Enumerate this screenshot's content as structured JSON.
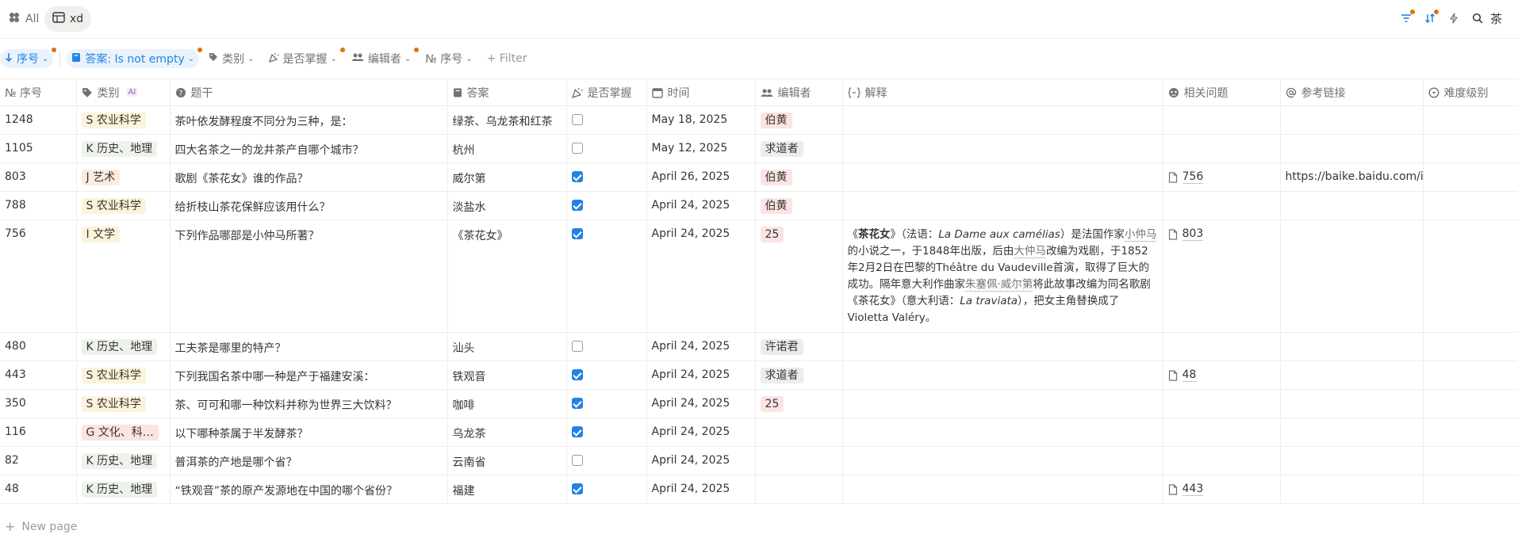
{
  "tabs": [
    {
      "label": "All",
      "icon": "clover-icon"
    },
    {
      "label": "xd",
      "icon": "table-icon"
    }
  ],
  "toolbar": {
    "search_query": "茶"
  },
  "filters": [
    {
      "label": "序号",
      "icon": "arrow-down-icon",
      "style": "blue",
      "dot": true
    },
    {
      "label": "答案: Is not empty",
      "icon": "book-icon",
      "style": "blue",
      "dot": true
    },
    {
      "label": "类别",
      "icon": "tag-icon",
      "style": "plain",
      "dot": false
    },
    {
      "label": "是否掌握",
      "icon": "party-icon",
      "style": "plain",
      "dot": true
    },
    {
      "label": "编辑者",
      "icon": "people-icon",
      "style": "plain",
      "dot": true
    },
    {
      "label": "№ 序号",
      "icon": "",
      "style": "plain",
      "dot": false
    },
    {
      "label": "+ Filter",
      "icon": "",
      "style": "muted",
      "dot": false
    }
  ],
  "columns": {
    "num": "№ 序号",
    "category": "类别",
    "ai_badge": "AI",
    "question": "题干",
    "answer": "答案",
    "mastered": "是否掌握",
    "date": "时间",
    "editor": "编辑者",
    "explanation": "解释",
    "related": "相关问题",
    "link": "参考链接",
    "difficulty": "难度级别"
  },
  "rows": [
    {
      "num": "1248",
      "category": "S 农业科学",
      "cat_color": "#fbf3db",
      "question": "茶叶依发酵程度不同分为三种，是：",
      "answer": "绿茶、乌龙茶和红茶",
      "mastered": false,
      "date": "May 18, 2025",
      "editor": "伯黄",
      "editor_color": "#fbe4e4",
      "related": "",
      "link": ""
    },
    {
      "num": "1105",
      "category": "K 历史、地理",
      "cat_color": "#edf3ec",
      "question": "四大名茶之一的龙井茶产自哪个城市？",
      "answer": "杭州",
      "mastered": false,
      "date": "May 12, 2025",
      "editor": "求道者",
      "editor_color": "#ebeced",
      "related": "",
      "link": ""
    },
    {
      "num": "803",
      "category": "J 艺术",
      "cat_color": "#fbecdd",
      "question": "歌剧《茶花女》谁的作品？",
      "answer": "威尔第",
      "mastered": true,
      "date": "April 26, 2025",
      "editor": "伯黄",
      "editor_color": "#fbe4e4",
      "related": "756",
      "link": "https://baike.baidu.com/item/"
    },
    {
      "num": "788",
      "category": "S 农业科学",
      "cat_color": "#fbf3db",
      "question": "给折枝山茶花保鲜应该用什么？",
      "answer": "淡盐水",
      "mastered": true,
      "date": "April 24, 2025",
      "editor": "伯黄",
      "editor_color": "#fbe4e4",
      "related": "",
      "link": ""
    },
    {
      "num": "756",
      "category": "I 文学",
      "cat_color": "#fbf3db",
      "question": "下列作品哪部是小仲马所著？",
      "answer": "《茶花女》",
      "mastered": true,
      "date": "April 24, 2025",
      "editor": "25",
      "editor_color": "#fbe4e4",
      "related": "803",
      "link": "",
      "explanation": {
        "t1": "《",
        "b1": "茶花女",
        "t2": "》（法语：",
        "i1": "La Dame aux camélias",
        "t3": "）是法国作家",
        "u1": "小仲马",
        "t4": "的小说之一，于1848年出版，后由",
        "u2": "大仲马",
        "t5": "改编为戏剧，于1852年2月2日在巴黎的Théâtre du Vaudeville首演，取得了巨大的成功。隔年意大利作曲家",
        "u3": "朱塞佩·威尔第",
        "t6": "将此故事改编为同名歌剧《茶花女》（意大利语：",
        "i2": "La traviata",
        "t7": "），把女主角替换成了Violetta Valéry。"
      }
    },
    {
      "num": "480",
      "category": "K 历史、地理",
      "cat_color": "#edf3ec",
      "question": "工夫茶是哪里的特产？",
      "answer": "汕头",
      "mastered": false,
      "date": "April 24, 2025",
      "editor": "许诺君",
      "editor_color": "#ebeced",
      "related": "",
      "link": ""
    },
    {
      "num": "443",
      "category": "S 农业科学",
      "cat_color": "#fbf3db",
      "question": "下列我国名茶中哪一种是产于福建安溪：",
      "answer": "铁观音",
      "mastered": true,
      "date": "April 24, 2025",
      "editor": "求道者",
      "editor_color": "#ebeced",
      "related": "48",
      "link": ""
    },
    {
      "num": "350",
      "category": "S 农业科学",
      "cat_color": "#fbf3db",
      "question": "茶、可可和哪一种饮料并称为世界三大饮料？",
      "answer": "咖啡",
      "mastered": true,
      "date": "April 24, 2025",
      "editor": "25",
      "editor_color": "#fbe4e4",
      "related": "",
      "link": ""
    },
    {
      "num": "116",
      "category": "G 文化、科…",
      "cat_color": "#fbe4e4",
      "question": "以下哪种茶属于半发酵茶？",
      "answer": "乌龙茶",
      "mastered": true,
      "date": "April 24, 2025",
      "editor": "",
      "editor_color": "",
      "related": "",
      "link": ""
    },
    {
      "num": "82",
      "category": "K 历史、地理",
      "cat_color": "#edf3ec",
      "question": "普洱茶的产地是哪个省？",
      "answer": "云南省",
      "mastered": false,
      "date": "April 24, 2025",
      "editor": "",
      "editor_color": "",
      "related": "",
      "link": ""
    },
    {
      "num": "48",
      "category": "K 历史、地理",
      "cat_color": "#edf3ec",
      "question": "“铁观音”茶的原产发源地在中国的哪个省份？",
      "answer": "福建",
      "mastered": true,
      "date": "April 24, 2025",
      "editor": "",
      "editor_color": "",
      "related": "443",
      "link": ""
    }
  ],
  "footer": {
    "new_page": "New page"
  }
}
